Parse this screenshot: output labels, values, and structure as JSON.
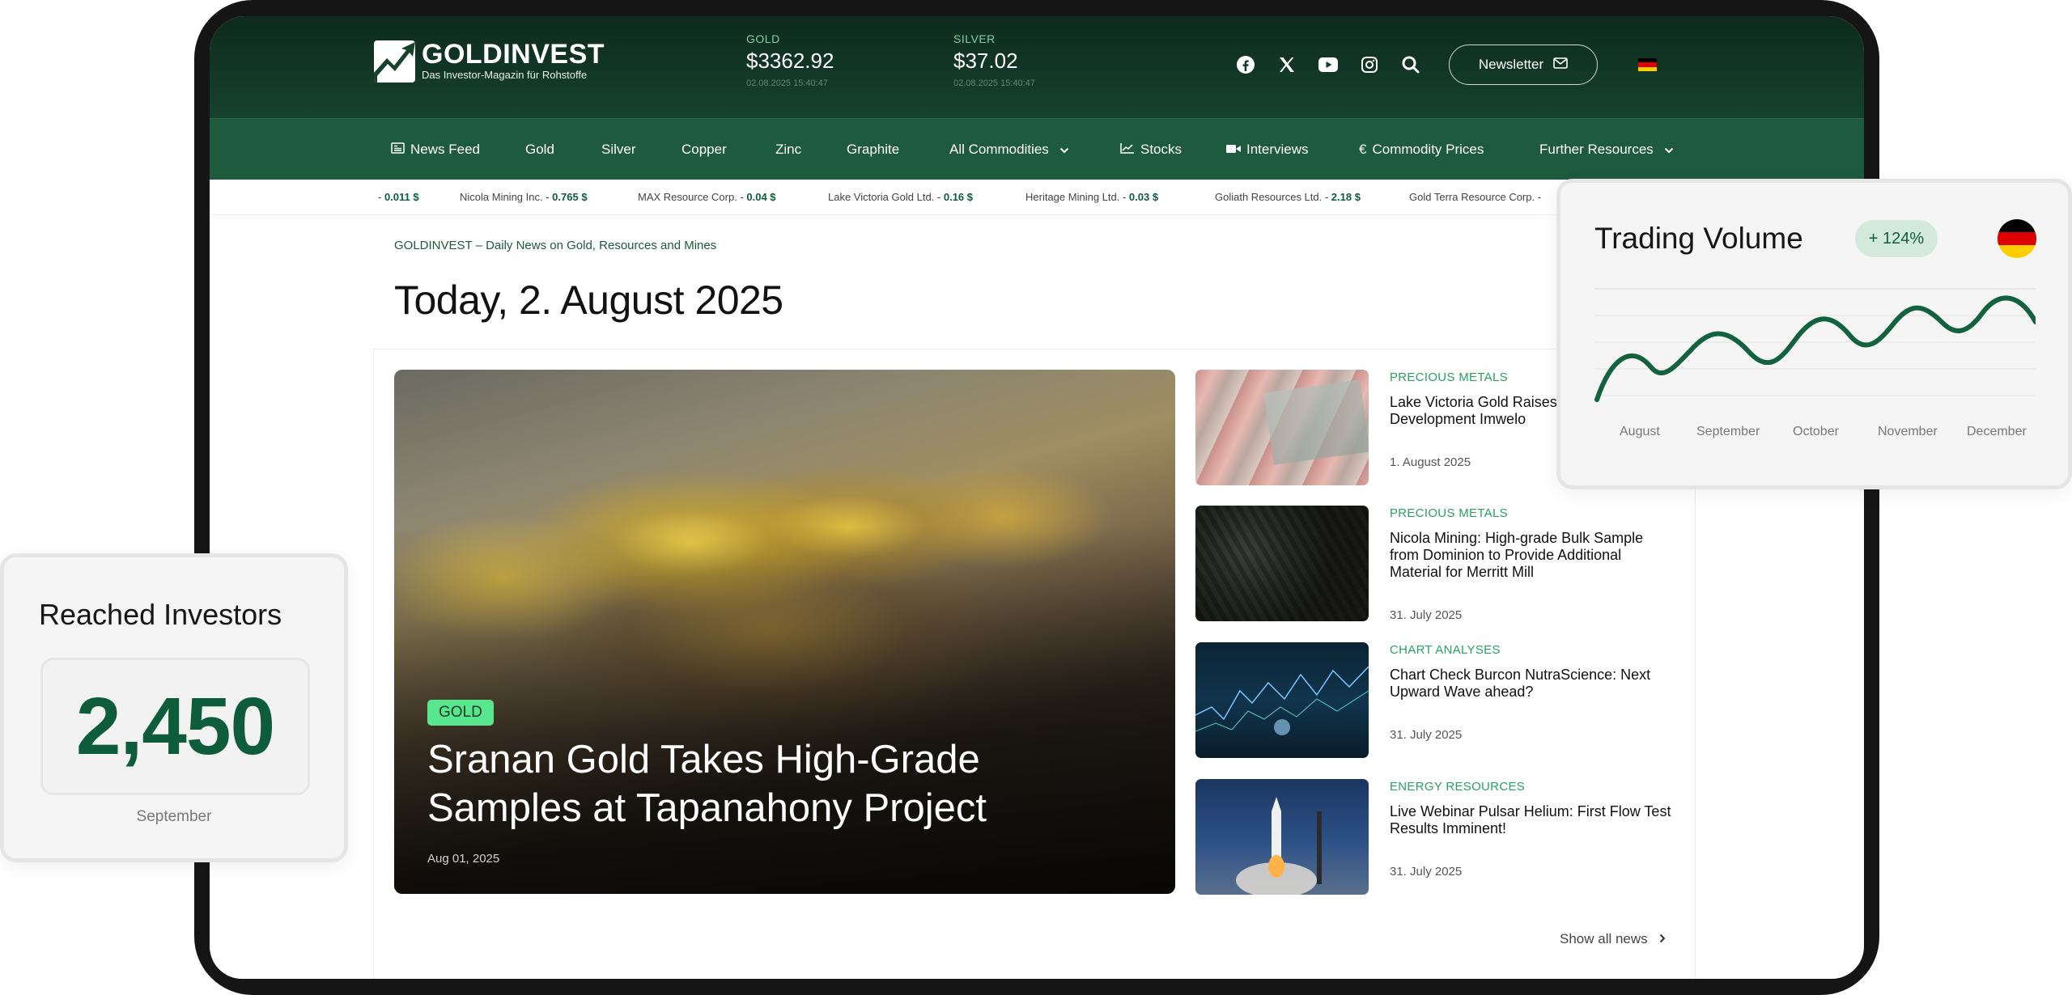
{
  "header": {
    "logo_name": "GOLDINVEST",
    "logo_tagline": "Das Investor-Magazin für Rohstoffe",
    "gold": {
      "label": "GOLD",
      "value": "$3362.92",
      "timestamp": "02.08.2025 15:40:47"
    },
    "silver": {
      "label": "SILVER",
      "value": "$37.02",
      "timestamp": "02.08.2025 15:40:47"
    },
    "social_icons": [
      "facebook-icon",
      "x-icon",
      "youtube-icon",
      "instagram-icon",
      "search-icon"
    ],
    "newsletter_label": "Newsletter"
  },
  "nav": {
    "items": [
      {
        "label": "News Feed",
        "icon": "newspaper-icon"
      },
      {
        "label": "Gold"
      },
      {
        "label": "Silver"
      },
      {
        "label": "Copper"
      },
      {
        "label": "Zinc"
      },
      {
        "label": "Graphite"
      },
      {
        "label": "All Commodities",
        "icon": "chevron-down-icon"
      },
      {
        "label": "Stocks",
        "icon": "chart-line-icon"
      },
      {
        "label": "Interviews",
        "icon": "video-icon"
      },
      {
        "label": "Commodity Prices",
        "icon": "euro-icon"
      },
      {
        "label": "Further Resources",
        "icon": "chevron-down-icon"
      }
    ]
  },
  "ticker": [
    {
      "name": "",
      "value": "0.011 $"
    },
    {
      "name": "Nicola Mining Inc.",
      "value": "0.765 $"
    },
    {
      "name": "MAX Resource Corp.",
      "value": "0.04 $"
    },
    {
      "name": "Lake Victoria Gold Ltd.",
      "value": "0.16 $"
    },
    {
      "name": "Heritage Mining Ltd.",
      "value": "0.03 $"
    },
    {
      "name": "Goliath Resources Ltd.",
      "value": "2.18 $"
    },
    {
      "name": "Gold Terra Resource Corp.",
      "value": ""
    }
  ],
  "main": {
    "breadcrumb": "GOLDINVEST – Daily News on Gold, Resources and Mines",
    "title": "Today, 2. August 2025",
    "hero": {
      "badge": "GOLD",
      "title": "Sranan Gold Takes High-Grade Samples at Tapanahony Project",
      "date": "Aug 01, 2025"
    },
    "articles": [
      {
        "category": "PRECIOUS METALS",
        "title": "Lake Victoria Gold Raises for further Development Imwelo",
        "date": "1. August 2025"
      },
      {
        "category": "PRECIOUS METALS",
        "title": "Nicola Mining: High-grade Bulk Sample from Dominion to Provide Additional Material for Merritt Mill",
        "date": "31. July 2025"
      },
      {
        "category": "CHART ANALYSES",
        "title": "Chart Check Burcon NutraScience: Next Upward Wave ahead?",
        "date": "31. July 2025"
      },
      {
        "category": "ENERGY RESOURCES",
        "title": "Live Webinar Pulsar Helium: First Flow Test Results Imminent!",
        "date": "31. July 2025"
      }
    ],
    "show_all": "Show all news"
  },
  "trading_volume": {
    "title": "Trading Volume",
    "badge": "+ 124%",
    "months": [
      "August",
      "September",
      "October",
      "November",
      "December"
    ]
  },
  "reached_investors": {
    "title": "Reached Investors",
    "value": "2,450",
    "month": "September"
  },
  "colors": {
    "header_dark": "#0d2a1d",
    "nav_green": "#1e5a3d",
    "accent_green": "#28a263",
    "brand_green": "#0d5c3b",
    "badge_green": "#58e68f"
  }
}
